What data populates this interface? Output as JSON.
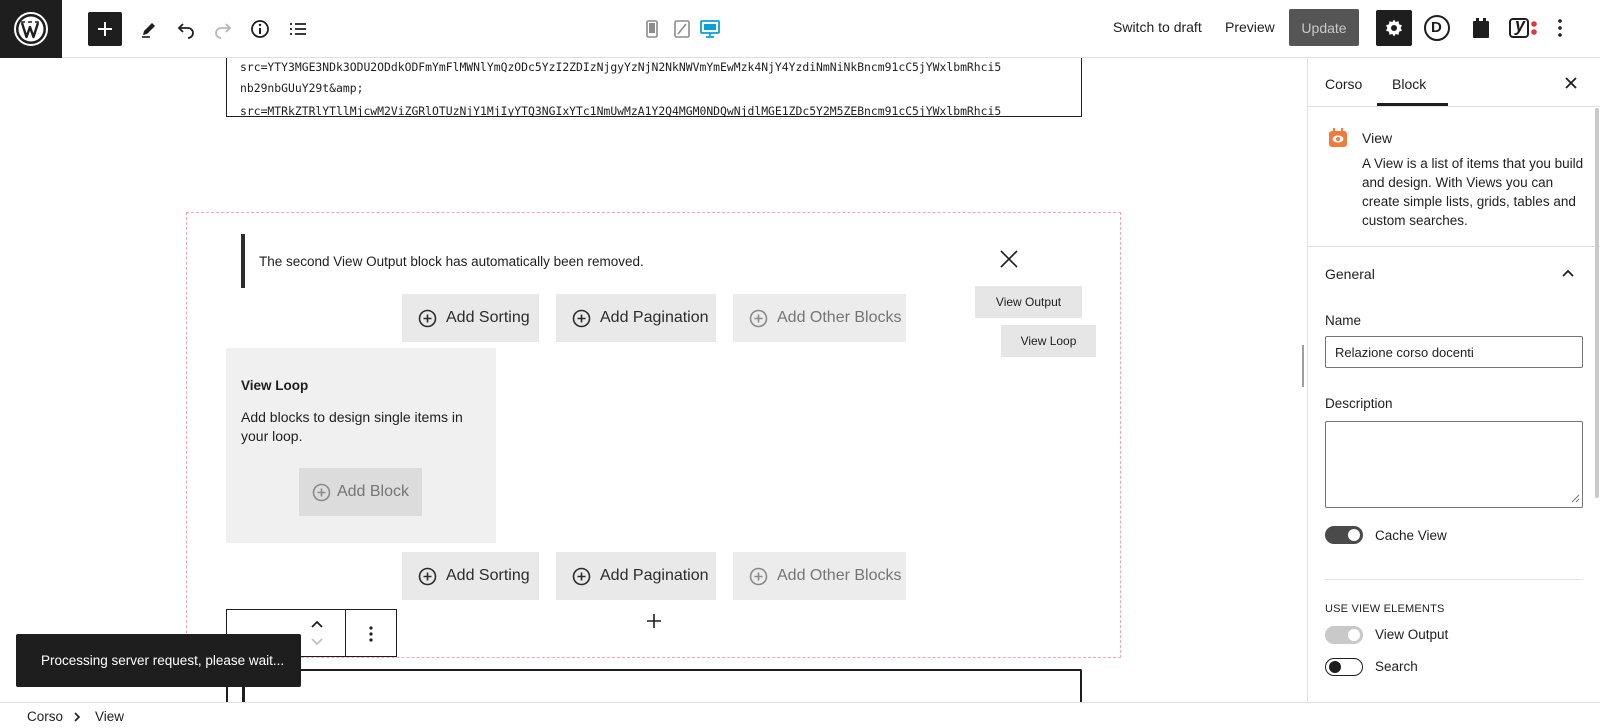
{
  "toolbar": {
    "switch_to_draft": "Switch to draft",
    "preview": "Preview",
    "update": "Update",
    "plugin_icon_letter": "D",
    "yoast_label": "y"
  },
  "canvas": {
    "code_lines": [
      "src=YTY3MGE3NDk3ODU2ODdkODFmYmFlMWNlYmQzODc5YzI2ZDIzNjgyYzNjN2NkNWVmYmEwMzk4NjY4YzdiNmNiNkBncm91cC5jYWxlbmRhci5",
      "nb29nbGUuY29t&amp;",
      "src=MTRkZTRlYTllMjcwM2ViZGRlOTUzNjY1MjIyYTQ3NGIxYTc1NmUwMzA1Y2Q4MGM0NDQwNjdlMGE1ZDc5Y2M5ZEBncm91cC5jYWxlbmRhci5"
    ],
    "notice_text": "The second View Output block has automatically been removed.",
    "add_sorting": "Add Sorting",
    "add_pagination": "Add Pagination",
    "add_other_blocks": "Add Other Blocks",
    "view_output_label": "View Output",
    "view_loop_label": "View Loop",
    "loop_title": "View Loop",
    "loop_desc": "Add blocks to design single items in your loop.",
    "add_block": "Add Block"
  },
  "snackbar": {
    "text": "Processing server request, please wait..."
  },
  "breadcrumb": {
    "items": [
      "Corso",
      "View"
    ]
  },
  "sidebar": {
    "tabs": [
      "Corso",
      "Block"
    ],
    "active_tab": "Block",
    "block_title": "View",
    "block_desc": "A View is a list of items that you build and design. With Views you can create simple lists, grids, tables and custom searches.",
    "panel_title": "General",
    "name_label": "Name",
    "name_value": "Relazione corso docenti",
    "description_label": "Description",
    "description_value": "",
    "cache_view_label": "Cache View",
    "cache_view_on": true,
    "section_heading": "USE VIEW ELEMENTS",
    "view_output_label": "View Output",
    "view_output_on": true,
    "search_label": "Search",
    "search_on": false
  },
  "colors": {
    "accent_device": "#0a9fd6",
    "block_icon": "#f07b3f",
    "dashed_border": "#f0a7ae",
    "dark": "#1e1e1e"
  }
}
